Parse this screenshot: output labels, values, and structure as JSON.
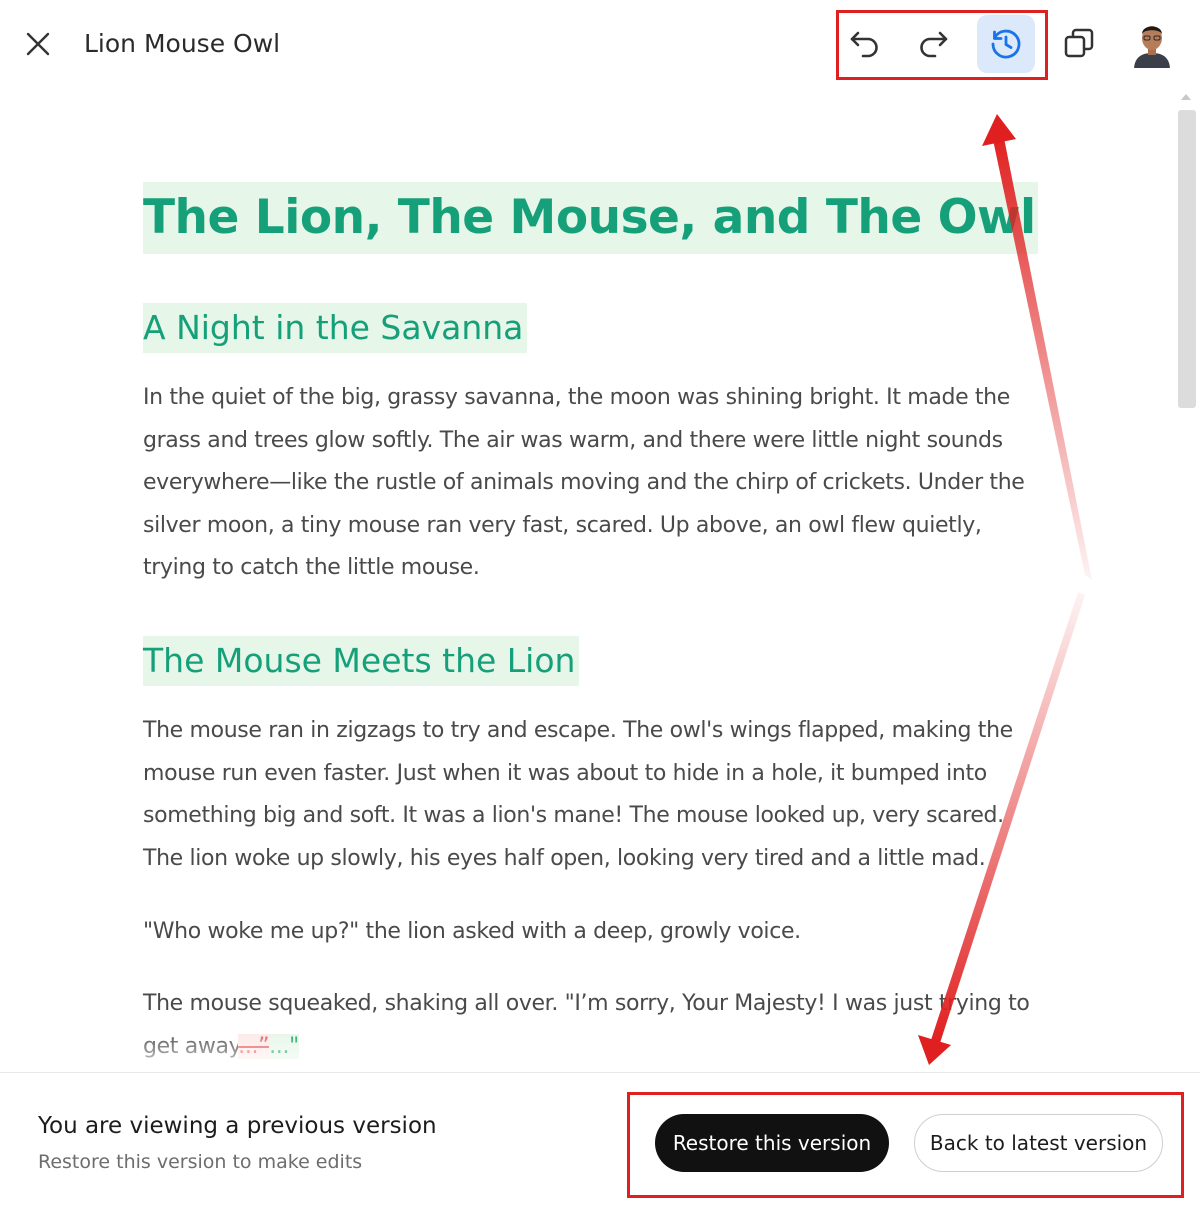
{
  "header": {
    "title": "Lion Mouse Owl",
    "close_icon": "close-icon",
    "undo_icon": "undo-icon",
    "redo_icon": "redo-icon",
    "history_icon": "version-history-icon",
    "copy_icon": "copy-icon",
    "avatar": "user-avatar"
  },
  "document": {
    "title": "The Lion, The Mouse, and The Owl",
    "section1": {
      "heading": "A Night in the Savanna",
      "paragraph": "In the quiet of the big, grassy savanna, the moon was shining bright. It made the grass and trees glow softly. The air was warm, and there were little night sounds everywhere—like the rustle of animals moving and the chirp of crickets. Under the silver moon, a tiny mouse ran very fast, scared. Up above, an owl flew quietly, trying to catch the little mouse."
    },
    "section2": {
      "heading": "The Mouse Meets the Lion",
      "paragraph1": "The mouse ran in zigzags to try and escape. The owl's wings flapped, making the mouse run even faster. Just when it was about to hide in a hole, it bumped into something big and soft. It was a lion's mane! The mouse looked up, very scared. The lion woke up slowly, his eyes half open, looking very tired and a little mad.",
      "paragraph2": "\"Who woke me up?\" the lion asked with a deep, growly voice.",
      "paragraph3_start": "The mouse squeaked, shaking all over. \"I’m sorry, Your Majesty! I was just trying to get away",
      "deleted_text": "...”",
      "inserted_text": "...\""
    }
  },
  "banner": {
    "title": "You are viewing a previous version",
    "subtitle": "Restore this version to make edits",
    "restore_label": "Restore this version",
    "back_label": "Back to latest version"
  },
  "colors": {
    "heading": "#16a07a",
    "highlight": "#e6f6e9",
    "annotation": "#e02020",
    "active_tool": "#dce9fb"
  }
}
